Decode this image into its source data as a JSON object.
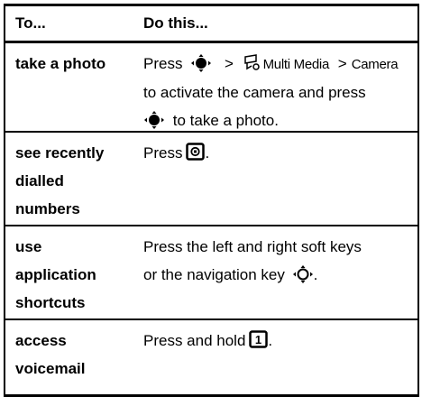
{
  "header": {
    "col1": "To...",
    "col2": "Do this..."
  },
  "rows": [
    {
      "task": "take a photo",
      "l1_a": "Press",
      "l1_gt1": ">",
      "l1_menu": "Multi Media",
      "l1_gt2": ">",
      "l1_item": "Camera",
      "l2": "to activate the camera and press",
      "l3": "to take a photo."
    },
    {
      "task_l1": "see recently",
      "task_l2": "dialled",
      "task_l3": "numbers",
      "action_a": "Press",
      "action_b": "."
    },
    {
      "task_l1": "use",
      "task_l2": "application",
      "task_l3": "shortcuts",
      "action_l1": "Press the left and right soft keys",
      "action_l2a": "or the navigation key",
      "action_l2b": "."
    },
    {
      "task_l1": "access",
      "task_l2": "voicemail",
      "action_a": "Press and hold",
      "action_b": ".",
      "key_label": "1"
    }
  ],
  "icons": {
    "nav_key": "navigation-key-icon",
    "nav_key_hollow": "navigation-key-outline-icon",
    "multimedia_menu": "multimedia-menu-icon",
    "send_key": "send-key-icon",
    "one_key": "one-key-icon"
  }
}
